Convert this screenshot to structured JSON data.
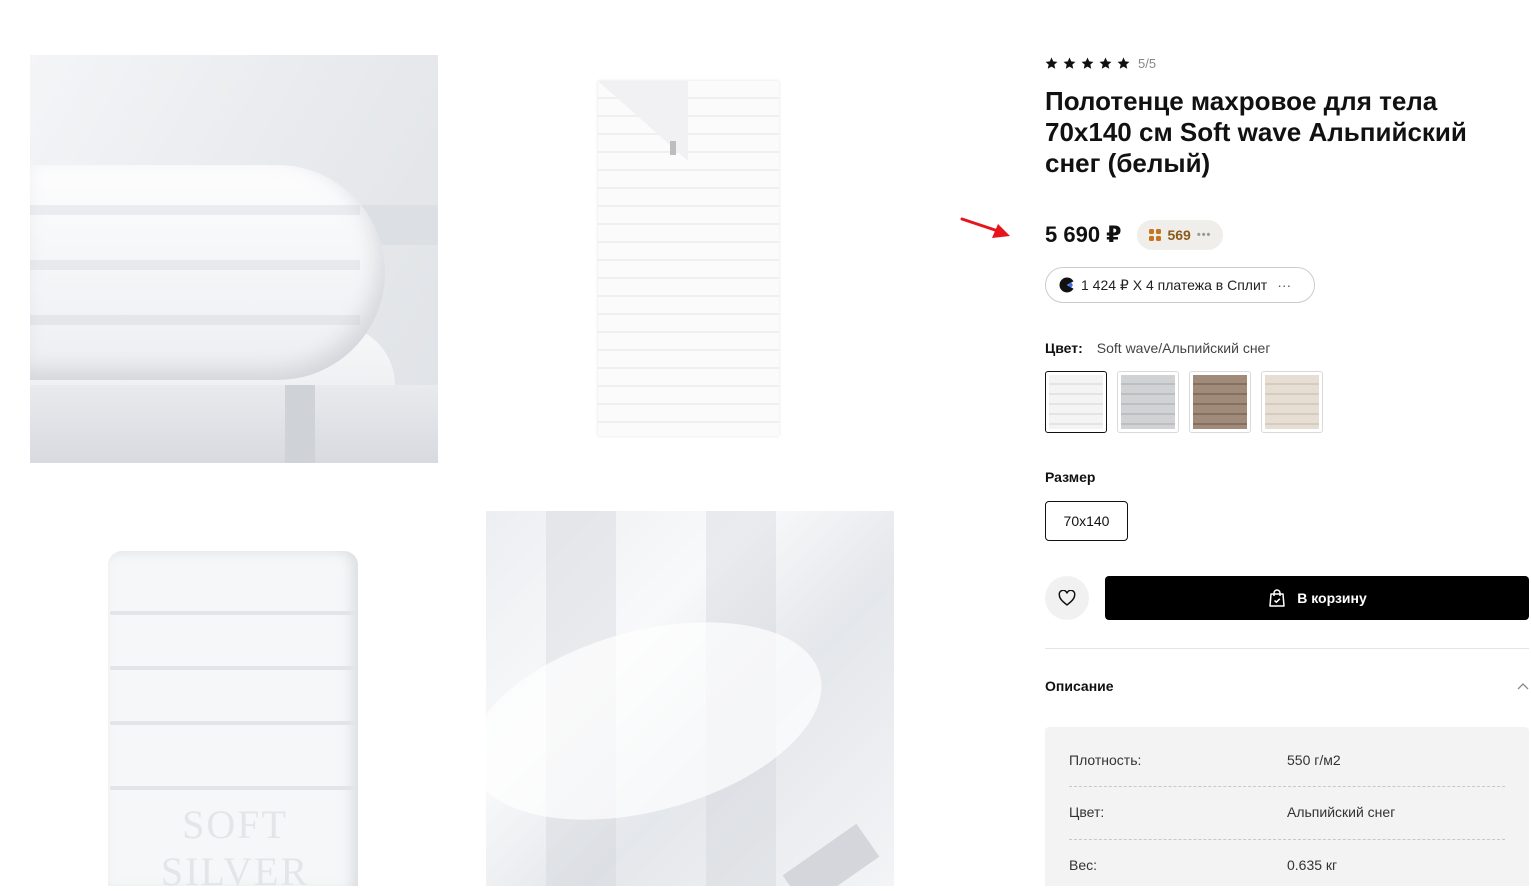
{
  "gallery": {
    "photos": [
      {
        "alt": "folded-towel-photo"
      },
      {
        "alt": "flat-towel-photo"
      },
      {
        "alt": "stacked-towel-photo"
      },
      {
        "alt": "towel-closeup-photo"
      }
    ],
    "stack_logo": "SOFT SILVER"
  },
  "product": {
    "rating_text": "5/5",
    "rating_value": 5,
    "title": "Полотенце махровое для тела 70х140 см Soft wave Альпийский снег (белый)",
    "price": "5 690 ₽",
    "bonus": "569",
    "bonus_dots": "•••",
    "split_text": "1 424 ₽ X 4 платежа в Сплит",
    "split_dots": "···",
    "color_label": "Цвет:",
    "color_value": "Soft wave/Альпийский снег",
    "swatches": [
      {
        "color": "#f2f2f3",
        "selected": true
      },
      {
        "color": "#c9cacd",
        "selected": false
      },
      {
        "color": "#8f7663",
        "selected": false
      },
      {
        "color": "#e3d8cb",
        "selected": false
      }
    ],
    "size_label": "Размер",
    "size_value": "70х140",
    "cart_label": "В корзину",
    "description_label": "Описание",
    "specs": [
      {
        "key": "Плотность:",
        "value": "550 г/м2"
      },
      {
        "key": "Цвет:",
        "value": "Альпийский снег"
      },
      {
        "key": "Вес:",
        "value": "0.635 кг"
      }
    ]
  },
  "colors": {
    "accent_red": "#e8141b",
    "bonus_bg": "#f0eeeb",
    "bonus_text": "#8a5a18",
    "button_bg": "#000000"
  }
}
